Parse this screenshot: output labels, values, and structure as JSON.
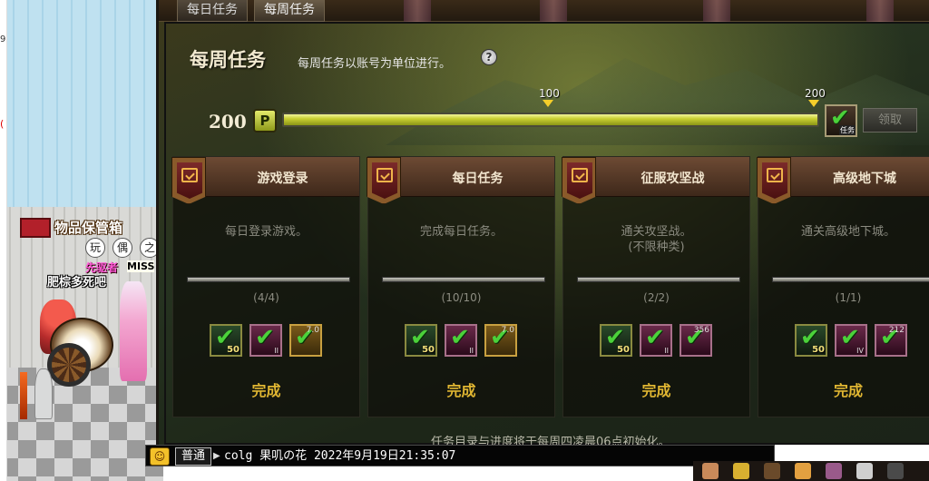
{
  "world": {
    "edge_num": "9",
    "edge_mark": "(",
    "npc_name": "物品保管箱",
    "emotes": [
      "玩",
      "偶",
      "之"
    ],
    "char_title": "先驱者",
    "char_miss": "MISS",
    "char_name": "肥棕多死吧"
  },
  "tabs": [
    {
      "label": "每日任务",
      "active": false
    },
    {
      "label": "每周任务",
      "active": true
    }
  ],
  "header": {
    "title": "每周任务",
    "subtitle": "每周任务以账号为单位进行。",
    "help_symbol": "?"
  },
  "progress": {
    "points": "200",
    "p_symbol": "P",
    "current": 200,
    "max": 200,
    "milestones": [
      {
        "label": "100",
        "value": 100
      },
      {
        "label": "200",
        "value": 200
      }
    ],
    "reward_tag": "任务",
    "claim_label": "领取"
  },
  "cards": [
    {
      "name": "游戏登录",
      "desc": [
        "每日登录游戏。"
      ],
      "count": "(4/4)",
      "items": [
        {
          "kind": "bag",
          "qty": "50"
        },
        {
          "kind": "pink",
          "lvl": "II"
        },
        {
          "kind": "gold",
          "num": "7.0"
        }
      ],
      "done": "完成"
    },
    {
      "name": "每日任务",
      "desc": [
        "完成每日任务。"
      ],
      "count": "(10/10)",
      "items": [
        {
          "kind": "bag",
          "qty": "50"
        },
        {
          "kind": "pink",
          "lvl": "II"
        },
        {
          "kind": "gold",
          "num": "7.0"
        }
      ],
      "done": "完成"
    },
    {
      "name": "征服攻坚战",
      "desc": [
        "通关攻坚战。",
        "(不限种类)"
      ],
      "count": "(2/2)",
      "items": [
        {
          "kind": "bag",
          "qty": "50"
        },
        {
          "kind": "pink",
          "lvl": "II"
        },
        {
          "kind": "pink",
          "num": "356"
        }
      ],
      "done": "完成"
    },
    {
      "name": "高级地下城",
      "desc": [
        "通关高级地下城。"
      ],
      "count": "(1/1)",
      "items": [
        {
          "kind": "bag",
          "qty": "50"
        },
        {
          "kind": "pink",
          "lvl": "IV"
        },
        {
          "kind": "pink",
          "num": "212"
        }
      ],
      "done": "完成"
    }
  ],
  "footer_note": "任务目录与进度将于每周四凌晨06点初始化。",
  "chat": {
    "emoticon": "☺",
    "channel": "普通",
    "caret": "▶",
    "text": "colg 果叽の花 2022年9月19日21:35:07"
  },
  "colors": {
    "accent_gold": "#e0b632",
    "check_green": "#4bd13a",
    "bar_fill": "#c9cf32"
  }
}
